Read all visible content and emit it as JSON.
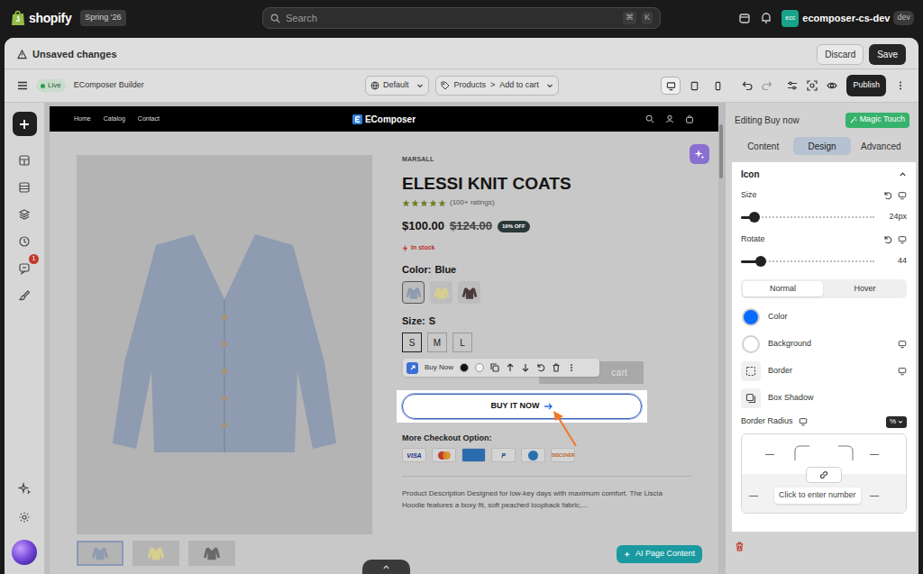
{
  "shopify_bar": {
    "brand": "shopify",
    "edition": "Spring '26",
    "search": {
      "placeholder": "Search",
      "keys": [
        "⌘",
        "K"
      ]
    },
    "store": {
      "avatar": "ecc",
      "name": "ecomposer-cs-dev",
      "tag": "dev"
    }
  },
  "save_bar": {
    "message": "Unsaved changes",
    "discard": "Discard",
    "save": "Save"
  },
  "toolbar": {
    "status": "Live",
    "app": "EComposer Builder",
    "theme": "Default",
    "breadcrumb": {
      "items": [
        "Products",
        "Add to cart"
      ],
      "separator": ">"
    },
    "devices": [
      {
        "selected": true
      },
      {
        "selected": false
      },
      {
        "selected": false
      }
    ],
    "publish": "Publish"
  },
  "sidebar": {
    "notification_count": "1"
  },
  "store_header": {
    "nav": [
      "Home",
      "Catalog",
      "Contact"
    ],
    "logo": "EComposer"
  },
  "product": {
    "vendor": "MARSALL",
    "title": "ELESSI KNIT COATS",
    "stars": 5,
    "ratings": "(100+ ratings)",
    "price": "$100.00",
    "compare_price": "$124.00",
    "discount": "19% OFF",
    "stock": "In stock",
    "color_label": "Color:",
    "color_value": "Blue",
    "swatches": [
      {
        "selected": true,
        "color": "#8e9bb0"
      },
      {
        "selected": false,
        "color": "#d8cf8e"
      },
      {
        "selected": false,
        "color": "#4a3c3c"
      }
    ],
    "size_label": "Size:",
    "size_value": "S",
    "sizes": [
      {
        "label": "S",
        "selected": true
      },
      {
        "label": "M",
        "selected": false
      },
      {
        "label": "L",
        "selected": false
      }
    ],
    "thumbnails": [
      {
        "selected": true,
        "color": "#8e9bb0"
      },
      {
        "selected": false,
        "color": "#d8cf8e"
      },
      {
        "selected": false,
        "color": "#6a6a6a"
      }
    ],
    "add_to_cart": "cart",
    "buy_now": {
      "label": "BUY IT NOW",
      "selected": true
    },
    "checkout_title": "More Checkout Option:",
    "payments": [
      {
        "kind": "text",
        "label": "VISA",
        "color": "#1a2a8a"
      },
      {
        "kind": "mastercard"
      },
      {
        "kind": "amex",
        "color": "#2b6cb0"
      },
      {
        "kind": "text",
        "label": "P",
        "color": "#1a3f8a"
      },
      {
        "kind": "diners",
        "color": "#2a6fb0"
      },
      {
        "kind": "text",
        "label": "DISCOVER",
        "color": "#c05a20"
      }
    ],
    "description": [
      "Product Description Designed for low-key days with maximum comfort. The Liscia",
      "Hoodie features a boxy fit, soft peached loopback fabric,..."
    ]
  },
  "element_toolbar": {
    "label": "Buy Now",
    "swatches": [
      {
        "color": "#111111"
      },
      {
        "color": "#f2f2f2"
      }
    ]
  },
  "ai_button": "AI Page Content",
  "panel": {
    "title": "Editing Buy now",
    "magic": "Magic Touch",
    "tabs": [
      {
        "label": "Content",
        "selected": false
      },
      {
        "label": "Design",
        "selected": true
      },
      {
        "label": "Advanced",
        "selected": false
      }
    ],
    "section": {
      "title": "Icon",
      "expanded": true
    },
    "sliders": [
      {
        "label": "Size",
        "level": 0.1,
        "reading": "24px"
      },
      {
        "label": "Rotate",
        "level": 0.15,
        "reading": "44"
      }
    ],
    "states": [
      {
        "label": "Normal",
        "selected": true
      },
      {
        "label": "Hover",
        "selected": false
      }
    ],
    "properties": [
      {
        "label": "Color",
        "kind": "swatch",
        "color": "#0a6cff",
        "responsive": false
      },
      {
        "label": "Background",
        "kind": "swatch",
        "color": "#ffffff",
        "responsive": true
      },
      {
        "label": "Border",
        "kind": "border",
        "responsive": true
      },
      {
        "label": "Box Shadow",
        "kind": "shadow",
        "responsive": false
      }
    ],
    "radius": {
      "label": "Border Radius",
      "unit": "%",
      "corners": [
        "—",
        "—",
        "—",
        "—"
      ],
      "linked": false,
      "tooltip": "Click to enter number"
    }
  }
}
